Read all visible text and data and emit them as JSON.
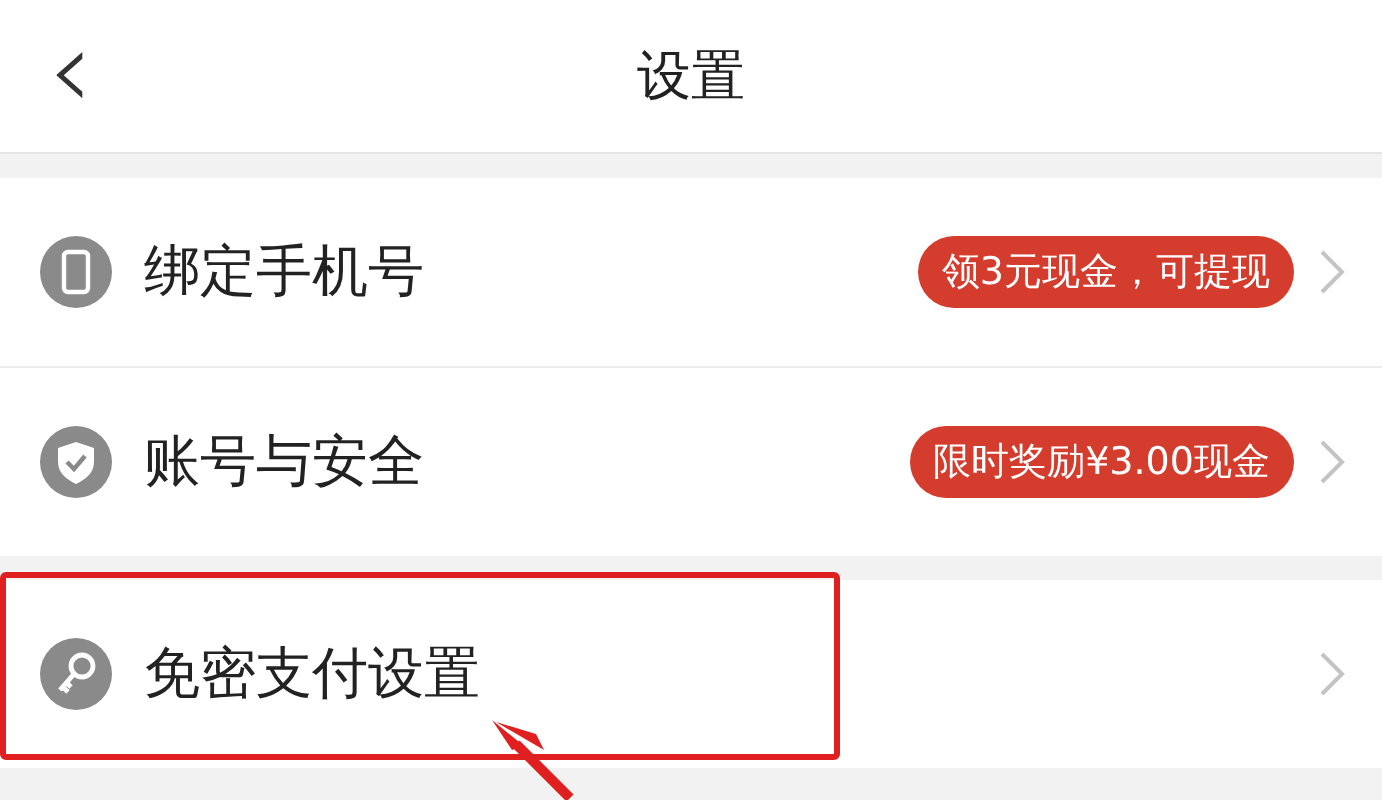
{
  "header": {
    "back": "‹",
    "title": "设置"
  },
  "groups": [
    {
      "items": [
        {
          "kind": "phone",
          "label": "绑定手机号",
          "badge": "领3元现金，可提现",
          "highlighted": false
        },
        {
          "kind": "shield",
          "label": "账号与安全",
          "badge": "限时奖励¥3.00现金",
          "highlighted": false
        }
      ]
    },
    {
      "items": [
        {
          "kind": "key",
          "label": "免密支付设置",
          "highlighted": true
        }
      ]
    }
  ]
}
